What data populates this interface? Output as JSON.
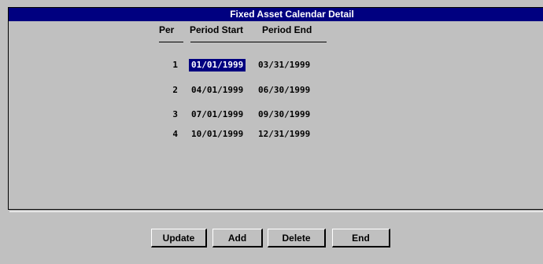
{
  "window": {
    "title": "Fixed Asset Calendar Detail"
  },
  "columns": {
    "per": "Per",
    "period_start": "Period Start",
    "period_end": "Period End"
  },
  "rows": [
    {
      "per": "1",
      "start": "01/01/1999",
      "end": "03/31/1999",
      "selected": true
    },
    {
      "per": "2",
      "start": "04/01/1999",
      "end": "06/30/1999",
      "selected": false
    },
    {
      "per": "3",
      "start": "07/01/1999",
      "end": "09/30/1999",
      "selected": false
    },
    {
      "per": "4",
      "start": "10/01/1999",
      "end": "12/31/1999",
      "selected": false
    }
  ],
  "buttons": {
    "update": "Update",
    "add": "Add",
    "delete": "Delete",
    "end": "End"
  },
  "colors": {
    "title_bar": "#000080",
    "background": "#c0c0c0",
    "selection": "#000080"
  }
}
